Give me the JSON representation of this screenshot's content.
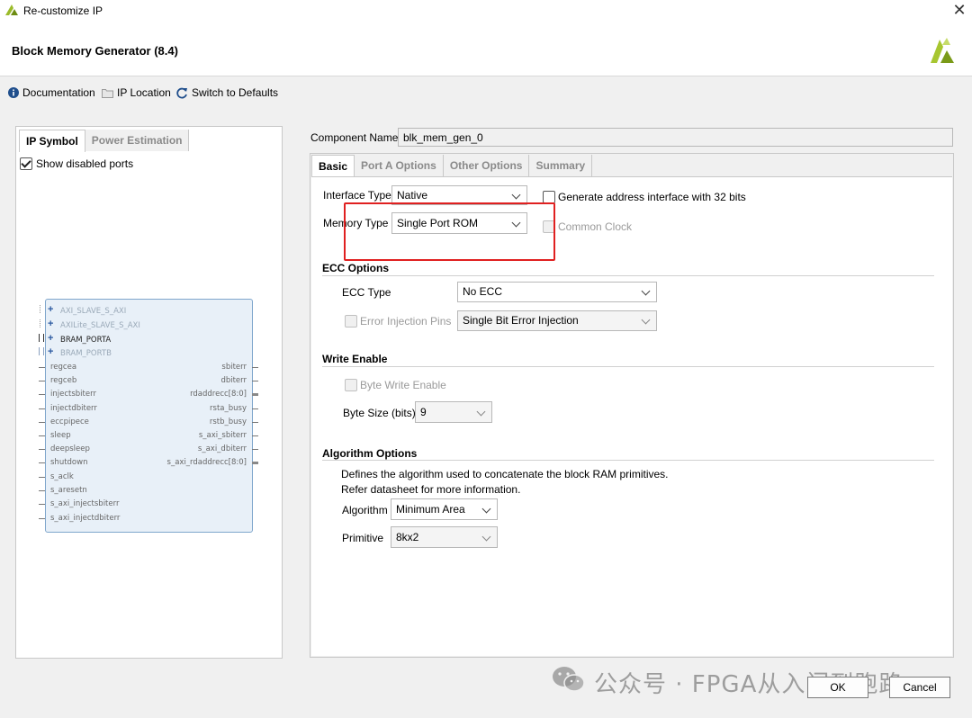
{
  "window": {
    "title": "Re-customize IP",
    "close_glyph": "✕"
  },
  "header": {
    "ip_title": "Block Memory Generator (8.4)"
  },
  "toolbar": {
    "documentation": "Documentation",
    "ip_location": "IP Location",
    "switch_defaults": "Switch to Defaults"
  },
  "left": {
    "tabs": [
      "IP Symbol",
      "Power Estimation"
    ],
    "show_disabled_ports": "Show disabled ports",
    "show_disabled_ports_checked": true,
    "symbol": {
      "interfaces": [
        "AXI_SLAVE_S_AXI",
        "AXILite_SLAVE_S_AXI",
        "BRAM_PORTA",
        "BRAM_PORTB"
      ],
      "left_ports": [
        "regcea",
        "regceb",
        "injectsbiterr",
        "injectdbiterr",
        "eccpipece",
        "sleep",
        "deepsleep",
        "shutdown",
        "s_aclk",
        "s_aresetn",
        "s_axi_injectsbiterr",
        "s_axi_injectdbiterr"
      ],
      "right_ports": [
        "sbiterr",
        "dbiterr",
        "rdaddrecc[8:0]",
        "rsta_busy",
        "rstb_busy",
        "s_axi_sbiterr",
        "s_axi_dbiterr",
        "s_axi_rdaddrecc[8:0]"
      ]
    }
  },
  "right": {
    "component_name_label": "Component Name",
    "component_name": "blk_mem_gen_0",
    "tabs": [
      "Basic",
      "Port A Options",
      "Other Options",
      "Summary"
    ],
    "interface_type_label": "Interface Type",
    "interface_type": "Native",
    "gen_addr_label": "Generate address interface with 32 bits",
    "memory_type_label": "Memory Type",
    "memory_type": "Single Port ROM",
    "common_clock_label": "Common Clock",
    "ecc": {
      "title": "ECC Options",
      "type_label": "ECC Type",
      "type": "No ECC",
      "error_pins_label": "Error Injection Pins",
      "error_injection": "Single Bit Error Injection"
    },
    "write_enable": {
      "title": "Write Enable",
      "byte_write_label": "Byte Write Enable",
      "byte_size_label": "Byte Size (bits)",
      "byte_size": "9"
    },
    "algorithm": {
      "title": "Algorithm Options",
      "desc1": "Defines the algorithm used to concatenate the block RAM primitives.",
      "desc2": "Refer datasheet for more information.",
      "algorithm_label": "Algorithm",
      "algorithm": "Minimum Area",
      "primitive_label": "Primitive",
      "primitive": "8kx2"
    }
  },
  "footer": {
    "ok": "OK",
    "cancel": "Cancel"
  },
  "watermark": "公众号 · FPGA从入门到跑路",
  "colors": {
    "highlight_box": "#e02020",
    "info_icon": "#1f4e8c",
    "brand_green": "#8cb400"
  }
}
